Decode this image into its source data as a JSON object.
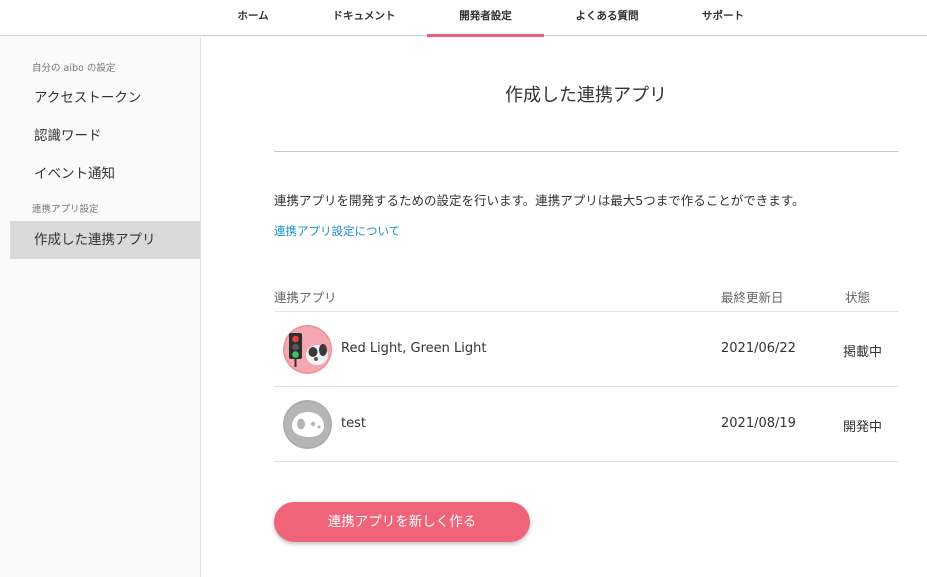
{
  "nav": {
    "tabs": [
      {
        "label": "ホーム"
      },
      {
        "label": "ドキュメント"
      },
      {
        "label": "開発者設定",
        "active": true
      },
      {
        "label": "よくある質問"
      },
      {
        "label": "サポート"
      }
    ]
  },
  "sidebar": {
    "section1": "自分の aibo の設定",
    "items1": [
      {
        "label": "アクセストークン"
      },
      {
        "label": "認識ワード"
      },
      {
        "label": "イベント通知"
      }
    ],
    "section2": "連携アプリ設定",
    "items2": [
      {
        "label": "作成した連携アプリ",
        "active": true
      }
    ]
  },
  "main": {
    "title": "作成した連携アプリ",
    "description": "連携アプリを開発するための設定を行います。連携アプリは最大5つまで作ることができます。",
    "help_link": "連携アプリ設定について",
    "table": {
      "headers": {
        "app": "連携アプリ",
        "updated": "最終更新日",
        "status": "状態"
      },
      "rows": [
        {
          "name": "Red Light, Green Light",
          "updated": "2021/06/22",
          "status": "掲載中",
          "icon": "traffic-light-aibo-icon"
        },
        {
          "name": "test",
          "updated": "2021/08/19",
          "status": "開発中",
          "icon": "aibo-default-icon"
        }
      ]
    },
    "create_button": "連携アプリを新しく作る"
  },
  "colors": {
    "accent": "#f0647a",
    "link": "#1a8fd0",
    "sidebar_active_bg": "#d9d9d9"
  }
}
